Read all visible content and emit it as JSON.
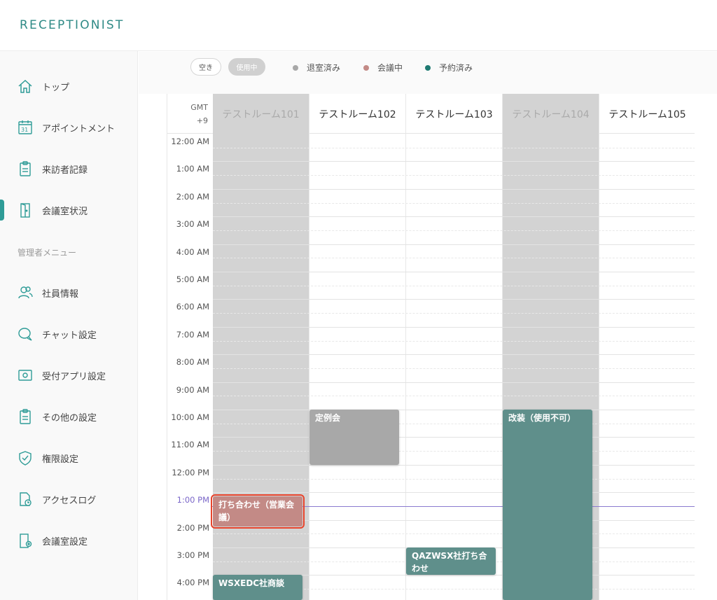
{
  "app": {
    "logo": "RECEPTIONIST"
  },
  "sidebar": {
    "items": [
      {
        "label": "トップ",
        "icon": "home-icon"
      },
      {
        "label": "アポイントメント",
        "icon": "calendar-icon"
      },
      {
        "label": "来訪者記録",
        "icon": "clipboard-icon"
      },
      {
        "label": "会議室状況",
        "icon": "door-icon",
        "active": true
      }
    ],
    "admin_section": "管理者メニュー",
    "admin_items": [
      {
        "label": "社員情報",
        "icon": "users-icon"
      },
      {
        "label": "チャット設定",
        "icon": "chat-icon"
      },
      {
        "label": "受付アプリ設定",
        "icon": "tablet-icon"
      },
      {
        "label": "その他の設定",
        "icon": "clipboard-settings-icon"
      },
      {
        "label": "権限設定",
        "icon": "shield-icon"
      },
      {
        "label": "アクセスログ",
        "icon": "document-clock-icon"
      },
      {
        "label": "会議室設定",
        "icon": "door-settings-icon"
      }
    ]
  },
  "legend": {
    "filter_free": "空き",
    "filter_used": "使用中",
    "items": [
      {
        "label": "退室済み",
        "color": "#a8a8a8"
      },
      {
        "label": "会議中",
        "color": "#c38a86"
      },
      {
        "label": "予約済み",
        "color": "#1f7a72"
      }
    ]
  },
  "calendar": {
    "timezone_line1": "GMT",
    "timezone_line2": "+9",
    "rooms": [
      {
        "name": "テストルーム101",
        "disabled": true
      },
      {
        "name": "テストルーム102",
        "disabled": false
      },
      {
        "name": "テストルーム103",
        "disabled": false
      },
      {
        "name": "テストルーム104",
        "disabled": true
      },
      {
        "name": "テストルーム105",
        "disabled": false
      }
    ],
    "hours": [
      "12:00 AM",
      "1:00 AM",
      "2:00 AM",
      "3:00 AM",
      "4:00 AM",
      "5:00 AM",
      "6:00 AM",
      "7:00 AM",
      "8:00 AM",
      "9:00 AM",
      "10:00 AM",
      "11:00 AM",
      "12:00 PM",
      "1:00 PM",
      "2:00 PM",
      "3:00 PM",
      "4:00 PM"
    ],
    "current_hour_label": "1:00 PM",
    "events": [
      {
        "title": "定例会",
        "room": 1,
        "start": 10.0,
        "end": 12.0,
        "status": "退室済み"
      },
      {
        "title": "改装（使用不可）",
        "room": 3,
        "start": 10.0,
        "end": 17.0,
        "status": "予約済み"
      },
      {
        "title": "打ち合わせ（営業会議）",
        "room": 0,
        "start": 13.15,
        "end": 14.25,
        "status": "会議中"
      },
      {
        "title": "QAZWSX社打ち合わせ",
        "room": 2,
        "start": 15.0,
        "end": 16.0,
        "status": "予約済み"
      },
      {
        "title": "WSXEDC社商談",
        "room": 0,
        "start": 16.0,
        "end": 17.0,
        "status": "予約済み"
      }
    ]
  }
}
